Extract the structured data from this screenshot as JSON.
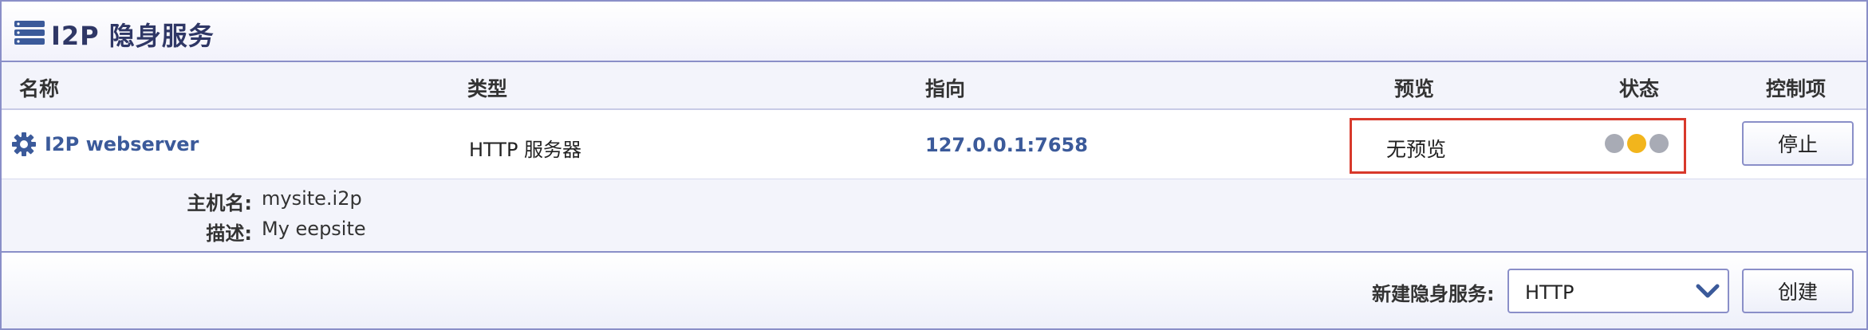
{
  "panel": {
    "title": "I2P 隐身服务",
    "title_icon": "server-stack-icon"
  },
  "table": {
    "headers": {
      "name": "名称",
      "type": "类型",
      "target": "指向",
      "preview": "预览",
      "status": "状态",
      "controls": "控制项"
    },
    "rows": [
      {
        "icon": "gear-icon",
        "name": "I2P webserver",
        "type": "HTTP 服务器",
        "target": "127.0.0.1:7658",
        "preview": "无预览",
        "status_lights": [
          "#a8abb5",
          "#f2b51c",
          "#a8abb5"
        ],
        "stop_label": "停止",
        "details": {
          "hostname_label": "主机名:",
          "hostname": "mysite.i2p",
          "description_label": "描述:",
          "description": "My eepsite"
        }
      }
    ]
  },
  "footer": {
    "new_service_label": "新建隐身服务:",
    "selected_type": "HTTP",
    "create_label": "创建"
  },
  "colors": {
    "accent": "#3b5a9a",
    "border": "#8a8fc8",
    "highlight": "#d8392b",
    "title": "#2f3766"
  }
}
